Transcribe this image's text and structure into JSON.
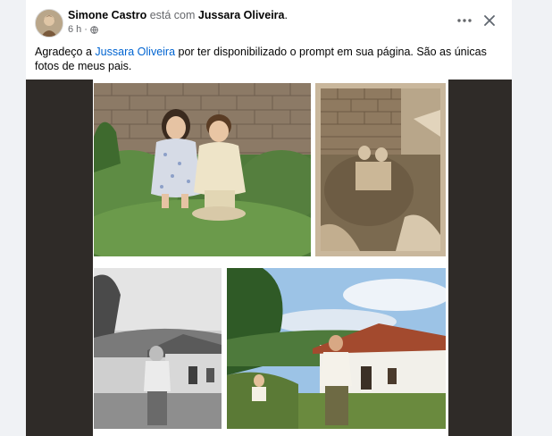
{
  "post": {
    "author": "Simone Castro",
    "with_text": "está com",
    "tagged": "Jussara Oliveira",
    "tagged_suffix": ".",
    "time": "6 h",
    "dot": "·",
    "audience_icon": "globe-icon",
    "more_icon": "more-horizontal-icon",
    "close_icon": "close-icon",
    "text_before": "Agradeço a ",
    "text_mention": "Jussara Oliveira",
    "text_after": " por ter disponibilizado o prompt em sua página. São as únicas fotos de meus pais."
  },
  "colors": {
    "mention": "#0064d1",
    "muted": "#65676b",
    "media_bg": "#2f2b28"
  }
}
